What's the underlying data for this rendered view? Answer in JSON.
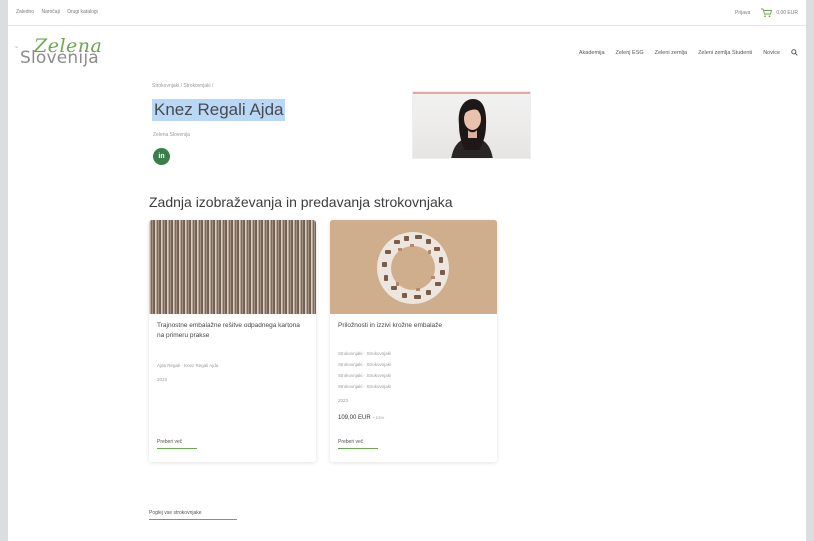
{
  "topbar": {
    "links": [
      "Zaledno",
      "Naročaji",
      "Drugi katalogi"
    ],
    "login": "Prijava",
    "cart_total": "0,00 EUR"
  },
  "logo": {
    "word1": "Zelena",
    "word2": "Slovenija"
  },
  "nav": {
    "items": [
      "Akademija",
      "Zelenj ESG",
      "Zeleni zemlja",
      "Zeleni zemlja Studenti",
      "Novice"
    ]
  },
  "profile": {
    "breadcrumb": "Strokovnjaki / Strokovnjaki /",
    "name": "Knez Regali Ajda",
    "subtitle": "Zelena Slovenija",
    "social": "in"
  },
  "section": {
    "title": "Zadnja izobraževanja in predavanja strokovnjaka"
  },
  "cards": [
    {
      "title": "Trajnostne embalažne rešitve odpadnega kartona na primeru prakse",
      "meta": [
        "Ajda Regali · Knez Regali Ajda",
        "2023"
      ],
      "more": "Preberi več"
    },
    {
      "title": "Priložnosti in izzivi krožne embalaže",
      "meta": [
        "Strokovnjaki · Strokovnjaki",
        "Strokovnjaki · Strokovnjaki",
        "Strokovnjaki · Strokovnjaki",
        "Strokovnjaki · Strokovnjaki",
        "2023"
      ],
      "price": "109,00 EUR",
      "price_note": "+ DDV",
      "more": "Preberi več"
    }
  ],
  "footer_link": "Poglej vse strokovnjake"
}
